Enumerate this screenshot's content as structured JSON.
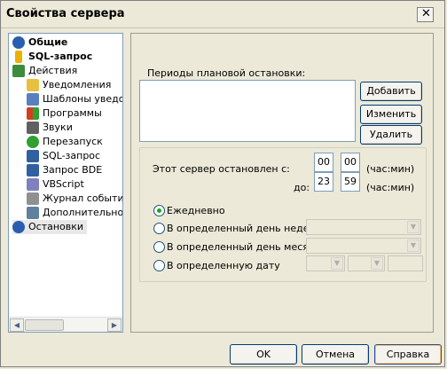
{
  "window": {
    "title": "Свойства сервера",
    "close_label": "✕"
  },
  "tree": {
    "items": [
      {
        "label": "Общие",
        "icon": "info-icon",
        "color": "#2a5db0",
        "bold": true
      },
      {
        "label": "SQL-запрос",
        "icon": "lightning-icon",
        "color": "#e8b400",
        "bold": true
      },
      {
        "label": "Действия",
        "icon": "puzzle-icon",
        "color": "#3c8c3c",
        "bold": false
      },
      {
        "label": "Уведомления",
        "icon": "folder-icon",
        "color": "#e8c040"
      },
      {
        "label": "Шаблоны уведомлений",
        "icon": "document-icon",
        "color": "#5a7fc0"
      },
      {
        "label": "Программы",
        "icon": "windows-icon",
        "color": "#d04020"
      },
      {
        "label": "Звуки",
        "icon": "speaker-icon",
        "color": "#606060"
      },
      {
        "label": "Перезапуск",
        "icon": "refresh-icon",
        "color": "#30a030"
      },
      {
        "label": "SQL-запрос",
        "icon": "sql-icon",
        "color": "#3060a0"
      },
      {
        "label": "Запрос BDE",
        "icon": "bde-icon",
        "color": "#3060a0"
      },
      {
        "label": "VBScript",
        "icon": "script-icon",
        "color": "#8080c0"
      },
      {
        "label": "Журнал событий",
        "icon": "log-icon",
        "color": "#909090"
      },
      {
        "label": "Дополнительно",
        "icon": "tools-icon",
        "color": "#6080a0"
      },
      {
        "label": "Остановки",
        "icon": "clock-icon",
        "color": "#2a5db0"
      }
    ]
  },
  "periods": {
    "label": "Периоды плановой остановки:",
    "add": "Добавить",
    "edit": "Изменить",
    "delete": "Удалить"
  },
  "stop": {
    "from_label": "Этот сервер остановлен с:",
    "to_label": "до:",
    "from_h": "00",
    "from_m": "00",
    "to_h": "23",
    "to_m": "59",
    "unit1": "(час:мин)",
    "unit2": "(час:мин)"
  },
  "schedule": {
    "daily": "Ежедневно",
    "weekday": "В определенный день недели",
    "monthday": "В определенный день месяца",
    "date": "В определенную дату",
    "selected": "daily"
  },
  "footer": {
    "ok": "OK",
    "cancel": "Отмена",
    "help": "Справка"
  }
}
